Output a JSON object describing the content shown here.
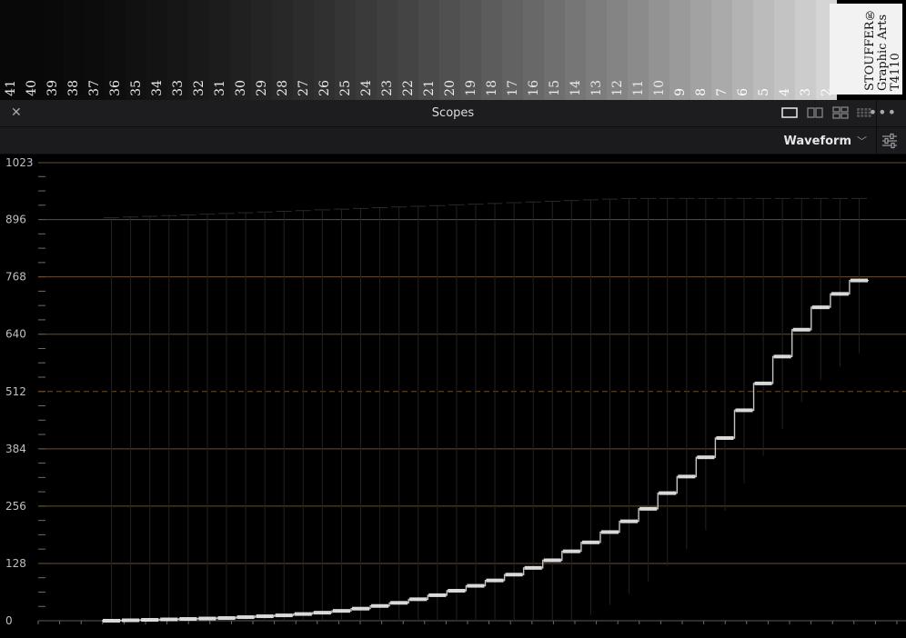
{
  "wedge": {
    "steps": [
      "41",
      "40",
      "39",
      "38",
      "37",
      "36",
      "35",
      "34",
      "33",
      "32",
      "31",
      "30",
      "29",
      "28",
      "27",
      "26",
      "25",
      "24",
      "23",
      "22",
      "21",
      "20",
      "19",
      "18",
      "17",
      "16",
      "15",
      "14",
      "13",
      "12",
      "11",
      "10",
      "9",
      "8",
      "7",
      "6",
      "5",
      "4",
      "3",
      "2"
    ],
    "brand_line1": "STOUFFER®",
    "brand_line2": "Graphic Arts",
    "brand_line3": "T4110"
  },
  "panel": {
    "title": "Scopes",
    "close_icon": "close-icon",
    "layout_icons": [
      "single-view-icon",
      "dual-view-icon",
      "quad-view-icon",
      "grid-view-icon"
    ],
    "more_icon": "more-options-icon"
  },
  "toolbar": {
    "scope_type": "Waveform",
    "settings_icon": "settings-sliders-icon"
  },
  "colors": {
    "gridline": "#6a4f2c",
    "label": "#bfbfc4",
    "trace": "#ffffff",
    "panel_bg": "#1d1d20"
  },
  "chart_data": {
    "type": "scatter",
    "title": "",
    "xlabel": "",
    "ylabel": "",
    "ylim": [
      0,
      1023
    ],
    "y_ticks": [
      "1023",
      "896",
      "768",
      "640",
      "512",
      "384",
      "256",
      "128",
      "0"
    ],
    "grid": true,
    "series": [
      {
        "name": "",
        "x_steps": [
          41,
          40,
          39,
          38,
          37,
          36,
          35,
          34,
          33,
          32,
          31,
          30,
          29,
          28,
          27,
          26,
          25,
          24,
          23,
          22,
          21,
          20,
          19,
          18,
          17,
          16,
          15,
          14,
          13,
          12,
          11,
          10,
          9,
          8,
          7,
          6,
          5,
          4,
          3,
          2
        ],
        "values": [
          0,
          1,
          2,
          3,
          4,
          5,
          6,
          8,
          10,
          12,
          15,
          18,
          22,
          27,
          33,
          40,
          48,
          57,
          67,
          78,
          90,
          103,
          118,
          135,
          155,
          175,
          198,
          222,
          250,
          285,
          322,
          365,
          408,
          470,
          530,
          590,
          650,
          700,
          730,
          760
        ]
      }
    ]
  }
}
